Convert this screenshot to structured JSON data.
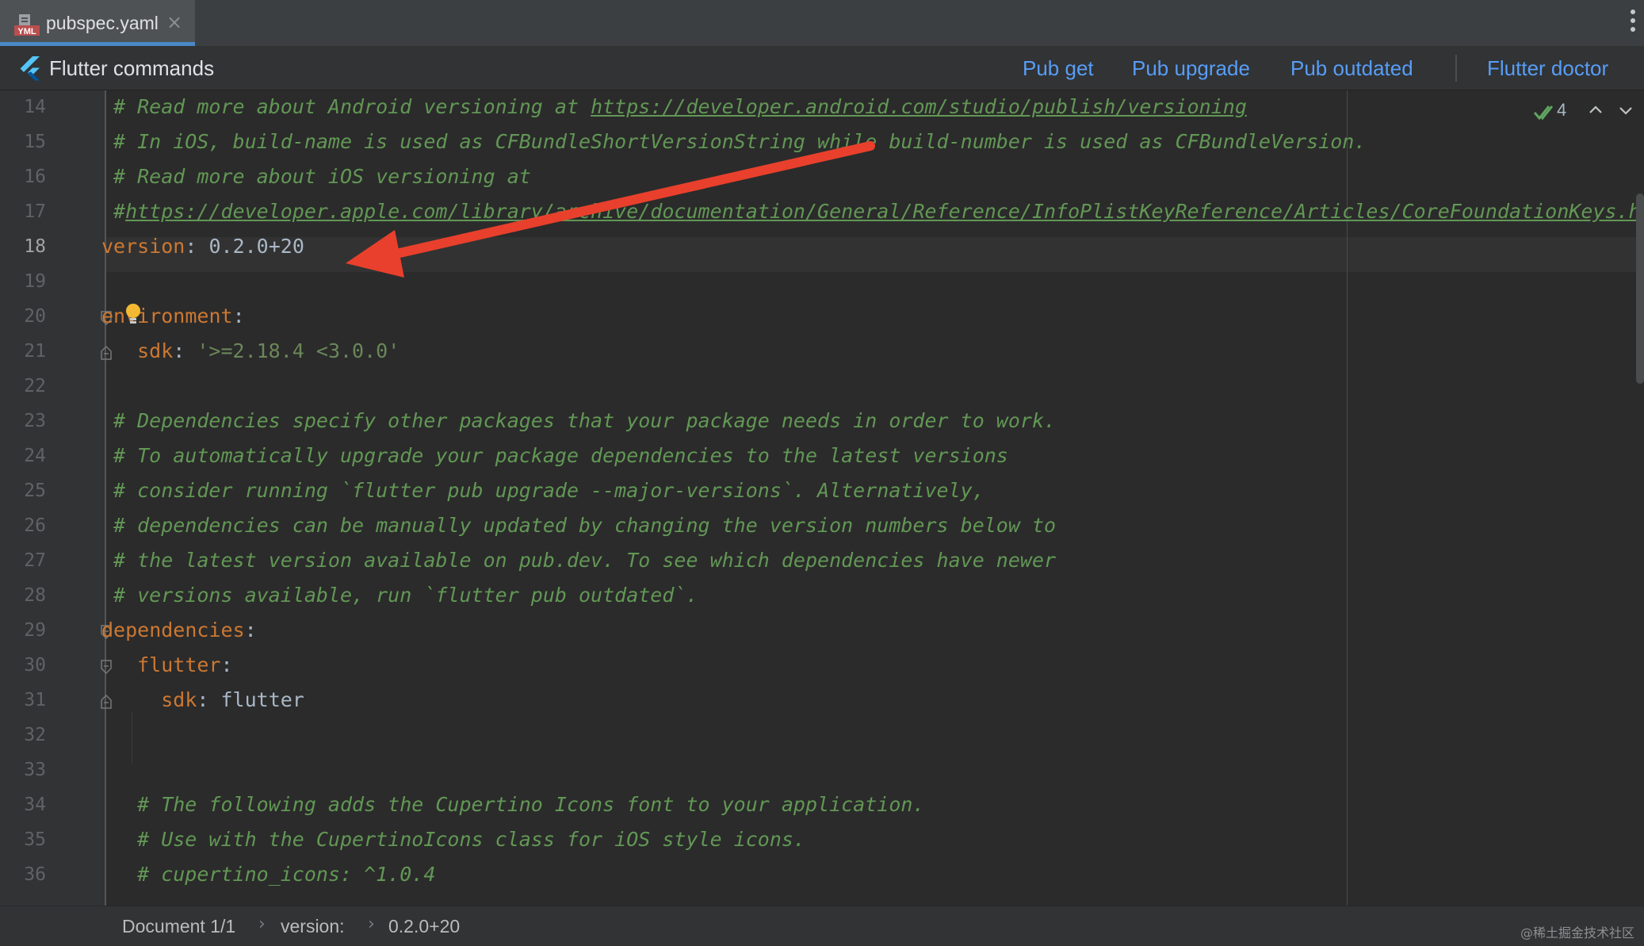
{
  "tab": {
    "file_name": "pubspec.yaml",
    "file_type_badge": "YML",
    "close_glyph": "×"
  },
  "commands_bar": {
    "title": "Flutter commands",
    "links": [
      "Pub get",
      "Pub upgrade",
      "Pub outdated",
      "Flutter doctor"
    ]
  },
  "inspections": {
    "count": "4"
  },
  "editor": {
    "active_line": 18,
    "line_numbers": [
      "14",
      "15",
      "16",
      "17",
      "18",
      "19",
      "20",
      "21",
      "22",
      "23",
      "24",
      "25",
      "26",
      "27",
      "28",
      "29",
      "30",
      "31",
      "32",
      "33",
      "34",
      "35",
      "36"
    ],
    "lines": [
      {
        "comment_prefix": "# Read more about Android versioning at ",
        "url": "https://developer.android.com/studio/publish/versioning"
      },
      {
        "comment": "# In iOS, build-name is used as CFBundleShortVersionString while build-number is used as CFBundleVersion."
      },
      {
        "comment": "# Read more about iOS versioning at"
      },
      {
        "comment_prefix": "#",
        "url": "https://developer.apple.com/library/archive/documentation/General/Reference/InfoPlistKeyReference/Articles/CoreFoundationKeys.html"
      },
      {
        "key": "version",
        "colon": ":",
        "value": " 0.2.0+20"
      },
      {
        "blank": ""
      },
      {
        "key": "environment",
        "colon": ":"
      },
      {
        "indent": "  ",
        "key": "sdk",
        "colon": ":",
        "value": " '>=2.18.4 <3.0.0'"
      },
      {
        "blank": ""
      },
      {
        "comment": "# Dependencies specify other packages that your package needs in order to work."
      },
      {
        "comment": "# To automatically upgrade your package dependencies to the latest versions"
      },
      {
        "comment": "# consider running `flutter pub upgrade --major-versions`. Alternatively,"
      },
      {
        "comment": "# dependencies can be manually updated by changing the version numbers below to"
      },
      {
        "comment": "# the latest version available on pub.dev. To see which dependencies have newer"
      },
      {
        "comment": "# versions available, run `flutter pub outdated`."
      },
      {
        "key": "dependencies",
        "colon": ":"
      },
      {
        "indent": "  ",
        "key": "flutter",
        "colon": ":"
      },
      {
        "indent": "    ",
        "key": "sdk",
        "colon": ":",
        "value": " flutter"
      },
      {
        "blank": ""
      },
      {
        "blank": ""
      },
      {
        "comment": "  # The following adds the Cupertino Icons font to your application."
      },
      {
        "comment": "  # Use with the CupertinoIcons class for iOS style icons."
      },
      {
        "comment": "  # cupertino_icons: ^1.0.4"
      }
    ]
  },
  "status_bar": {
    "crumbs": [
      "Document 1/1",
      "version:",
      "0.2.0+20"
    ],
    "watermark": "@稀土掘金技术社区"
  },
  "colors": {
    "accent_link": "#589df6",
    "annotation_arrow": "#e8402c",
    "comment": "#629755",
    "key": "#cc7832"
  }
}
